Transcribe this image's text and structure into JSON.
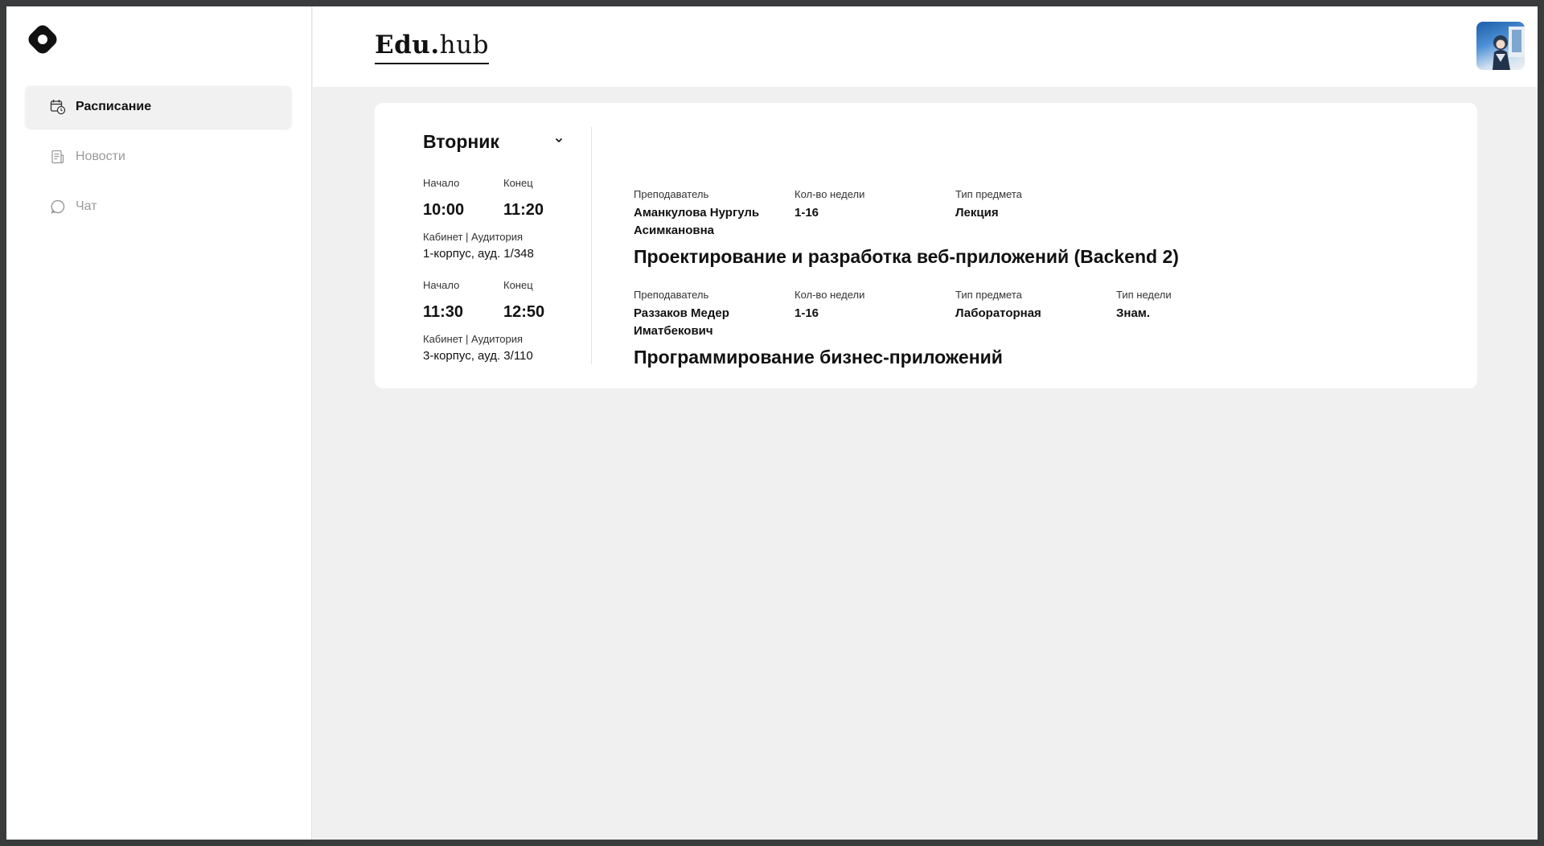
{
  "app": {
    "brand_bold": "Edu.",
    "brand_rest": "hub"
  },
  "sidebar": {
    "items": [
      {
        "label": "Расписание",
        "icon": "calendar-clock-icon",
        "active": true
      },
      {
        "label": "Новости",
        "icon": "news-icon",
        "active": false
      },
      {
        "label": "Чат",
        "icon": "chat-bubble-icon",
        "active": false
      }
    ]
  },
  "schedule": {
    "day": "Вторник",
    "start_label": "Начало",
    "end_label": "Конец",
    "room_label": "Кабинет | Аудитория",
    "teacher_label": "Преподаватель",
    "weeks_label": "Кол-во недели",
    "subject_type_label": "Тип предмета",
    "week_type_label": "Тип недели",
    "lessons": [
      {
        "start": "10:00",
        "end": "11:20",
        "room": "1-корпус, ауд. 1/348",
        "teacher_line1": "Аманкулова Нургуль",
        "teacher_line2": "Асимкановна",
        "weeks": "1-16",
        "subject_type": "Лекция",
        "subject": "Проектирование и разработка веб-приложений (Backend 2)"
      },
      {
        "start": "11:30",
        "end": "12:50",
        "room": "3-корпус, ауд. 3/110",
        "teacher_line1": "Раззаков Медер",
        "teacher_line2": "Иматбекович",
        "weeks": "1-16",
        "subject_type": "Лабораторная",
        "week_type": "Знам.",
        "subject": "Программирование бизнес-приложений"
      }
    ]
  },
  "colors": {
    "background": "#f0f0f0",
    "surface": "#ffffff",
    "text": "#111111",
    "muted": "#9a9a9a",
    "frame": "#3a3b3c"
  }
}
